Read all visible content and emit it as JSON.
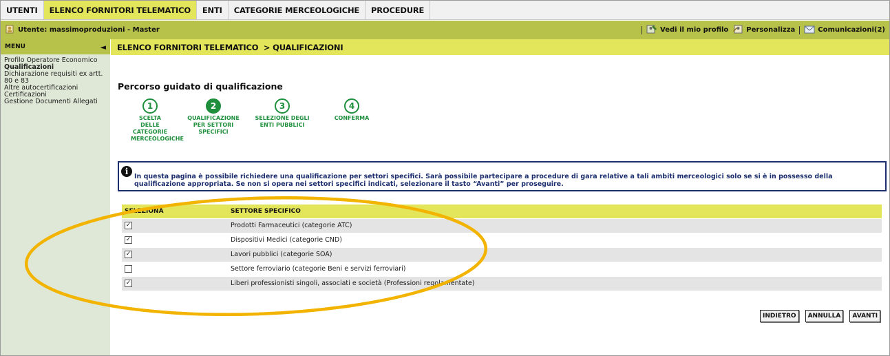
{
  "topnav": {
    "tabs": [
      {
        "label": "UTENTI",
        "active": false
      },
      {
        "label": "ELENCO FORNITORI TELEMATICO",
        "active": true
      },
      {
        "label": "ENTI",
        "active": false
      },
      {
        "label": "CATEGORIE MERCEOLOGICHE",
        "active": false
      },
      {
        "label": "PROCEDURE",
        "active": false
      }
    ]
  },
  "userbar": {
    "user_label": "Utente: massimoproduzioni - Master",
    "profile_link": "Vedi il mio profilo",
    "personalize_link": "Personalizza",
    "communications_link": "Comunicazioni(2)"
  },
  "sidebar": {
    "menu_title": "MENU",
    "collapse_glyph": "◄",
    "items": [
      {
        "label": "Profilo Operatore Economico",
        "bold": false
      },
      {
        "label": "Qualificazioni",
        "bold": true
      },
      {
        "label": "Dichiarazione requisiti ex artt.",
        "bold": false
      },
      {
        "label": "80 e 83",
        "bold": false
      },
      {
        "label": "Altre autocertificazioni",
        "bold": false
      },
      {
        "label": "Certificazioni",
        "bold": false
      },
      {
        "label": "Gestione Documenti Allegati",
        "bold": false
      }
    ]
  },
  "breadcrumb": "ELENCO FORNITORI TELEMATICO  > QUALIFICAZIONI",
  "wizard": {
    "title": "Percorso guidato di qualificazione",
    "steps": [
      {
        "number": "1",
        "label": "SCELTA DELLE CATEGORIE MERCEOLOGICHE",
        "current": false
      },
      {
        "number": "2",
        "label": "QUALIFICAZIONE PER SETTORI SPECIFICI",
        "current": true
      },
      {
        "number": "3",
        "label": "SELEZIONE DEGLI ENTI PUBBLICI",
        "current": false
      },
      {
        "number": "4",
        "label": "CONFERMA",
        "current": false
      }
    ]
  },
  "info": {
    "icon_glyph": "i",
    "text": "In questa pagina è possibile richiedere una qualificazione per settori specifici. Sarà possibile partecipare a procedure di gara relative a tali ambiti merceologici solo se si è in possesso della qualificazione appropriata. Se non si opera nei settori specifici indicati, selezionare il tasto “Avanti” per proseguire."
  },
  "table": {
    "headers": [
      "SELEZIONA",
      "SETTORE SPECIFICO"
    ],
    "rows": [
      {
        "checked": true,
        "settore": "Prodotti Farmaceutici (categorie ATC)"
      },
      {
        "checked": true,
        "settore": "Dispositivi Medici (categorie CND)"
      },
      {
        "checked": true,
        "settore": "Lavori pubblici (categorie SOA)"
      },
      {
        "checked": false,
        "settore": "Settore ferroviario (categorie Beni e servizi ferroviari)"
      },
      {
        "checked": true,
        "settore": "Liberi professionisti singoli, associati e società (Professioni regolamentate)"
      }
    ]
  },
  "buttons": {
    "back": "INDIETRO",
    "cancel": "ANNULLA",
    "next": "AVANTI"
  },
  "colors": {
    "accent_yellow": "#e3e55a",
    "olive": "#b7c24a",
    "sidebar_bg": "#dfe8d6",
    "step_green": "#1f8f3e",
    "info_navy": "#1c2e6e",
    "annotation_orange": "#f2b400"
  },
  "icons": {
    "user": "user-icon",
    "profile": "profile-icon",
    "personalize": "personalize-icon",
    "communications": "mail-icon",
    "info": "info-icon"
  }
}
